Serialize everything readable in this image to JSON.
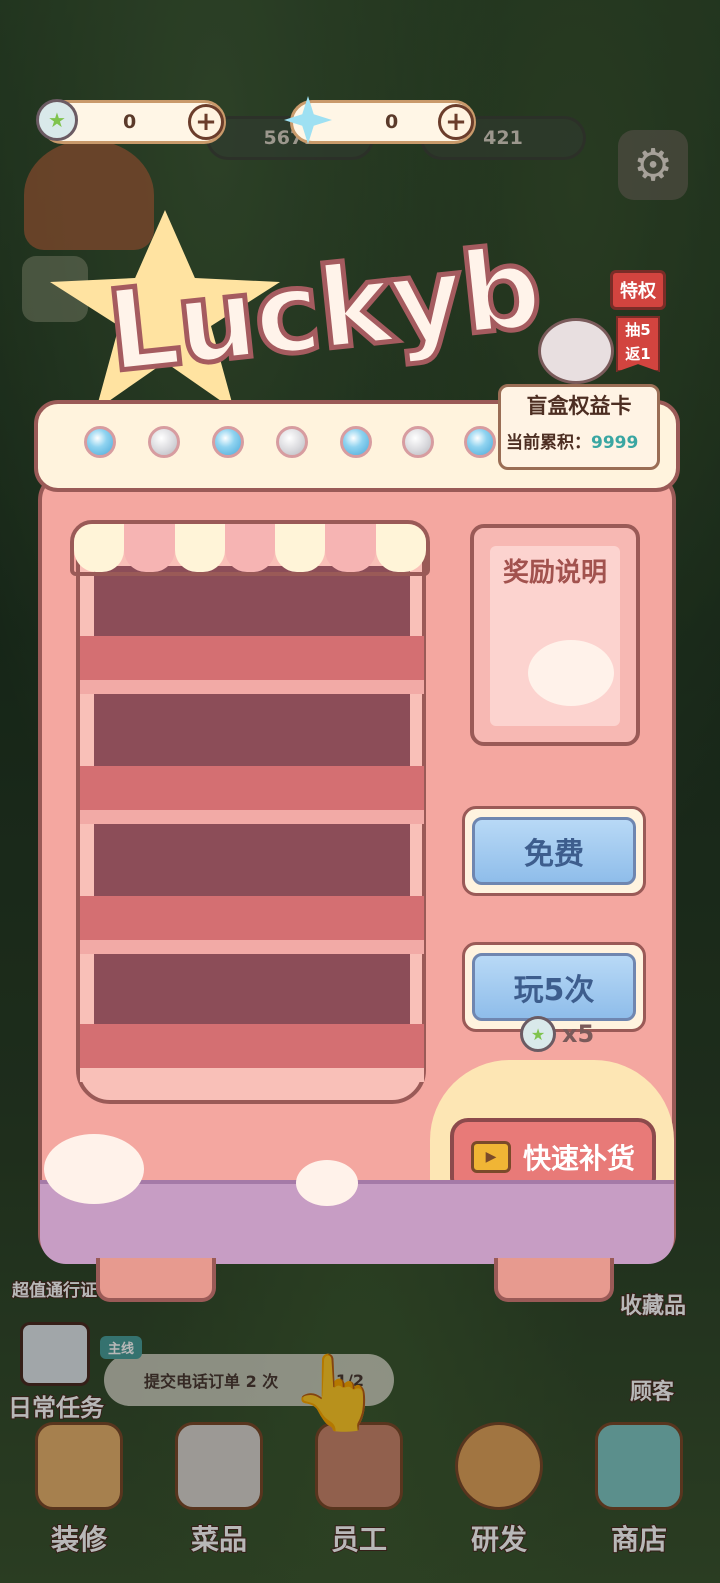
{
  "currency": {
    "coin_value": "0",
    "gem_value": "0",
    "bg_value_1": "5671",
    "bg_value_2": "421",
    "plus_symbol": "+"
  },
  "banner": {
    "title": "Luckyb",
    "privilege_tag": "特权",
    "bonus_tag": "抽5返1"
  },
  "benefit_card": {
    "title": "盲盒权益卡",
    "accumulated_label": "当前累积：",
    "accumulated_value": "9999"
  },
  "lights": [
    "on",
    "off",
    "on",
    "off",
    "on",
    "off",
    "on"
  ],
  "reward_panel": {
    "title": "奖励说明"
  },
  "buttons": {
    "free": "免费",
    "play5": "玩5次",
    "play5_cost": "x5",
    "restock": "快速补货"
  },
  "side_labels": {
    "pass": "超值通行证",
    "collection": "收藏品",
    "customers": "顾客",
    "daily_tasks": "日常任务"
  },
  "quest": {
    "tag": "主线",
    "text": "提交电话订单 2 次",
    "progress": "1/2"
  },
  "bottom_nav": [
    "装修",
    "菜品",
    "员工",
    "研发",
    "商店"
  ],
  "colors": {
    "machine_pink": "#f4a7a0",
    "outline": "#9a5a57",
    "button_blue": "#8fbdea",
    "restock_red": "#e87a78",
    "accent_teal": "#3aa6a2"
  }
}
